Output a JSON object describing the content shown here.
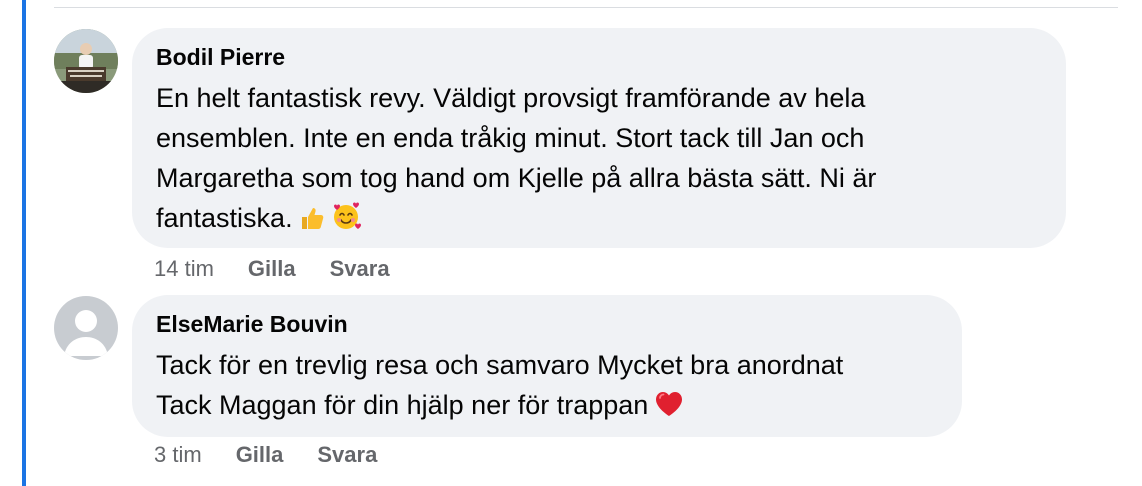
{
  "comments": [
    {
      "author": "Bodil Pierre",
      "text": "En helt fantastisk revy. Väldigt provsigt framförande av hela\nensemblen. Inte en enda tråkig minut. Stort tack till Jan och\nMargaretha som tog hand om Kjelle på allra bästa sätt. Ni är\nfantastiska.",
      "emojis": [
        "thumbs-up-emoji",
        "smiling-face-with-hearts-emoji"
      ],
      "time": "14 tim",
      "like_label": "Gilla",
      "reply_label": "Svara"
    },
    {
      "author": "ElseMarie Bouvin",
      "text": "Tack för en trevlig resa och samvaro Mycket bra anordnat\nTack Maggan för din hjälp ner för trappan",
      "emojis": [
        "red-heart-emoji"
      ],
      "time": "3 tim",
      "like_label": "Gilla",
      "reply_label": "Svara"
    }
  ],
  "colors": {
    "accent_bar": "#1b74e4",
    "bubble": "#f0f2f5",
    "meta_text": "#65676b"
  }
}
